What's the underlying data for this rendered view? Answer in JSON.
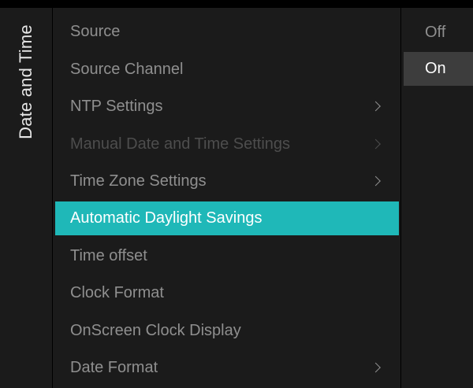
{
  "title": "Date and Time",
  "menu": [
    {
      "label": "Source",
      "state": "normal",
      "has_submenu": false
    },
    {
      "label": "Source Channel",
      "state": "normal",
      "has_submenu": false
    },
    {
      "label": "NTP Settings",
      "state": "normal",
      "has_submenu": true
    },
    {
      "label": "Manual Date and Time Settings",
      "state": "disabled",
      "has_submenu": true
    },
    {
      "label": "Time Zone Settings",
      "state": "normal",
      "has_submenu": true
    },
    {
      "label": "Automatic Daylight Savings",
      "state": "selected",
      "has_submenu": false
    },
    {
      "label": "Time offset",
      "state": "normal",
      "has_submenu": false
    },
    {
      "label": "Clock Format",
      "state": "normal",
      "has_submenu": false
    },
    {
      "label": "OnScreen Clock Display",
      "state": "normal",
      "has_submenu": false
    },
    {
      "label": "Date Format",
      "state": "normal",
      "has_submenu": true
    }
  ],
  "options": [
    {
      "label": "Off",
      "current": false
    },
    {
      "label": "On",
      "current": true
    }
  ],
  "colors": {
    "highlight": "#1fb8b8",
    "panel": "#1b1b1b",
    "text": "#8f8f8f",
    "text_disabled": "#4d4d4d",
    "option_current": "#3d3d3d"
  },
  "icons": {
    "submenu": "chevron-right-icon"
  }
}
